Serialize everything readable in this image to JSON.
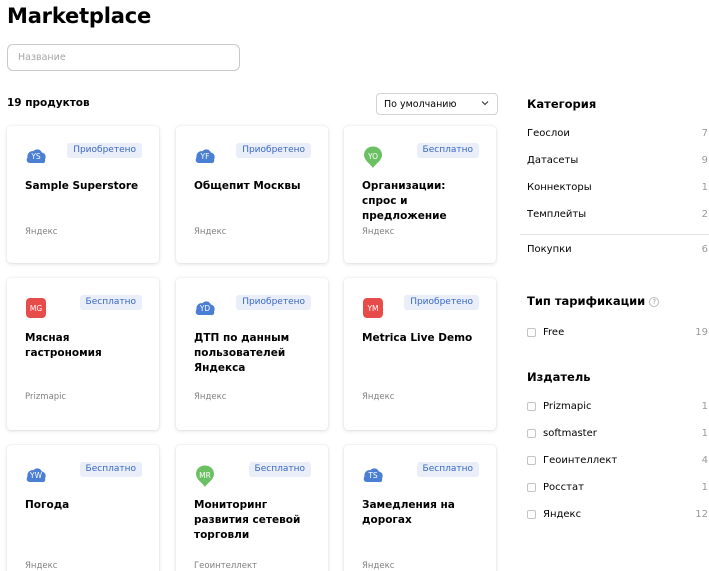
{
  "page_title": "Marketplace",
  "search": {
    "placeholder": "Название",
    "value": ""
  },
  "products_count": "19 продуктов",
  "sort": {
    "selected": "По умолчанию"
  },
  "cards": [
    {
      "initials": "YS",
      "icon_color": "#4a7fd3",
      "icon_shape": "cloud",
      "status": "Приобретено",
      "title": "Sample Superstore",
      "publisher": "Яндекс"
    },
    {
      "initials": "YF",
      "icon_color": "#4a7fd3",
      "icon_shape": "cloud",
      "status": "Приобретено",
      "title": "Общепит Москвы",
      "publisher": "Яндекс"
    },
    {
      "initials": "YO",
      "icon_color": "#6cc064",
      "icon_shape": "pin",
      "status": "Бесплатно",
      "title": "Организации: спрос и предложение",
      "publisher": "Яндекс"
    },
    {
      "initials": "MG",
      "icon_color": "#e84c4a",
      "icon_shape": "square",
      "status": "Бесплатно",
      "title": "Мясная гастрономия",
      "publisher": "Prizmapic"
    },
    {
      "initials": "YD",
      "icon_color": "#4a7fd3",
      "icon_shape": "cloud",
      "status": "Приобретено",
      "title": "ДТП по данным пользователей Яндекса",
      "publisher": "Яндекс"
    },
    {
      "initials": "YM",
      "icon_color": "#e84c4a",
      "icon_shape": "square",
      "status": "Приобретено",
      "title": "Metrica Live Demo",
      "publisher": "Яндекс"
    },
    {
      "initials": "YW",
      "icon_color": "#4a7fd3",
      "icon_shape": "cloud",
      "status": "Бесплатно",
      "title": "Погода",
      "publisher": "Яндекс"
    },
    {
      "initials": "MR",
      "icon_color": "#6cc064",
      "icon_shape": "pin",
      "status": "Бесплатно",
      "title": "Мониторинг развития сетевой торговли",
      "publisher": "Геоинтеллект"
    },
    {
      "initials": "TS",
      "icon_color": "#4a7fd3",
      "icon_shape": "cloud",
      "status": "Бесплатно",
      "title": "Замедления на дорогах",
      "publisher": "Яндекс"
    }
  ],
  "sidebar": {
    "category": {
      "heading": "Категория",
      "items": [
        {
          "label": "Геослои",
          "count": "7"
        },
        {
          "label": "Датасеты",
          "count": "9"
        },
        {
          "label": "Коннекторы",
          "count": "1"
        },
        {
          "label": "Темплейты",
          "count": "2"
        }
      ],
      "purchases": {
        "label": "Покупки",
        "count": "6"
      }
    },
    "tariff": {
      "heading": "Тип тарификации",
      "help": "?",
      "items": [
        {
          "label": "Free",
          "count": "19"
        }
      ]
    },
    "publisher": {
      "heading": "Издатель",
      "items": [
        {
          "label": "Prizmapic",
          "count": "1"
        },
        {
          "label": "softmaster",
          "count": "1"
        },
        {
          "label": "Геоинтеллект",
          "count": "4"
        },
        {
          "label": "Росстат",
          "count": "1"
        },
        {
          "label": "Яндекс",
          "count": "12"
        }
      ]
    }
  }
}
